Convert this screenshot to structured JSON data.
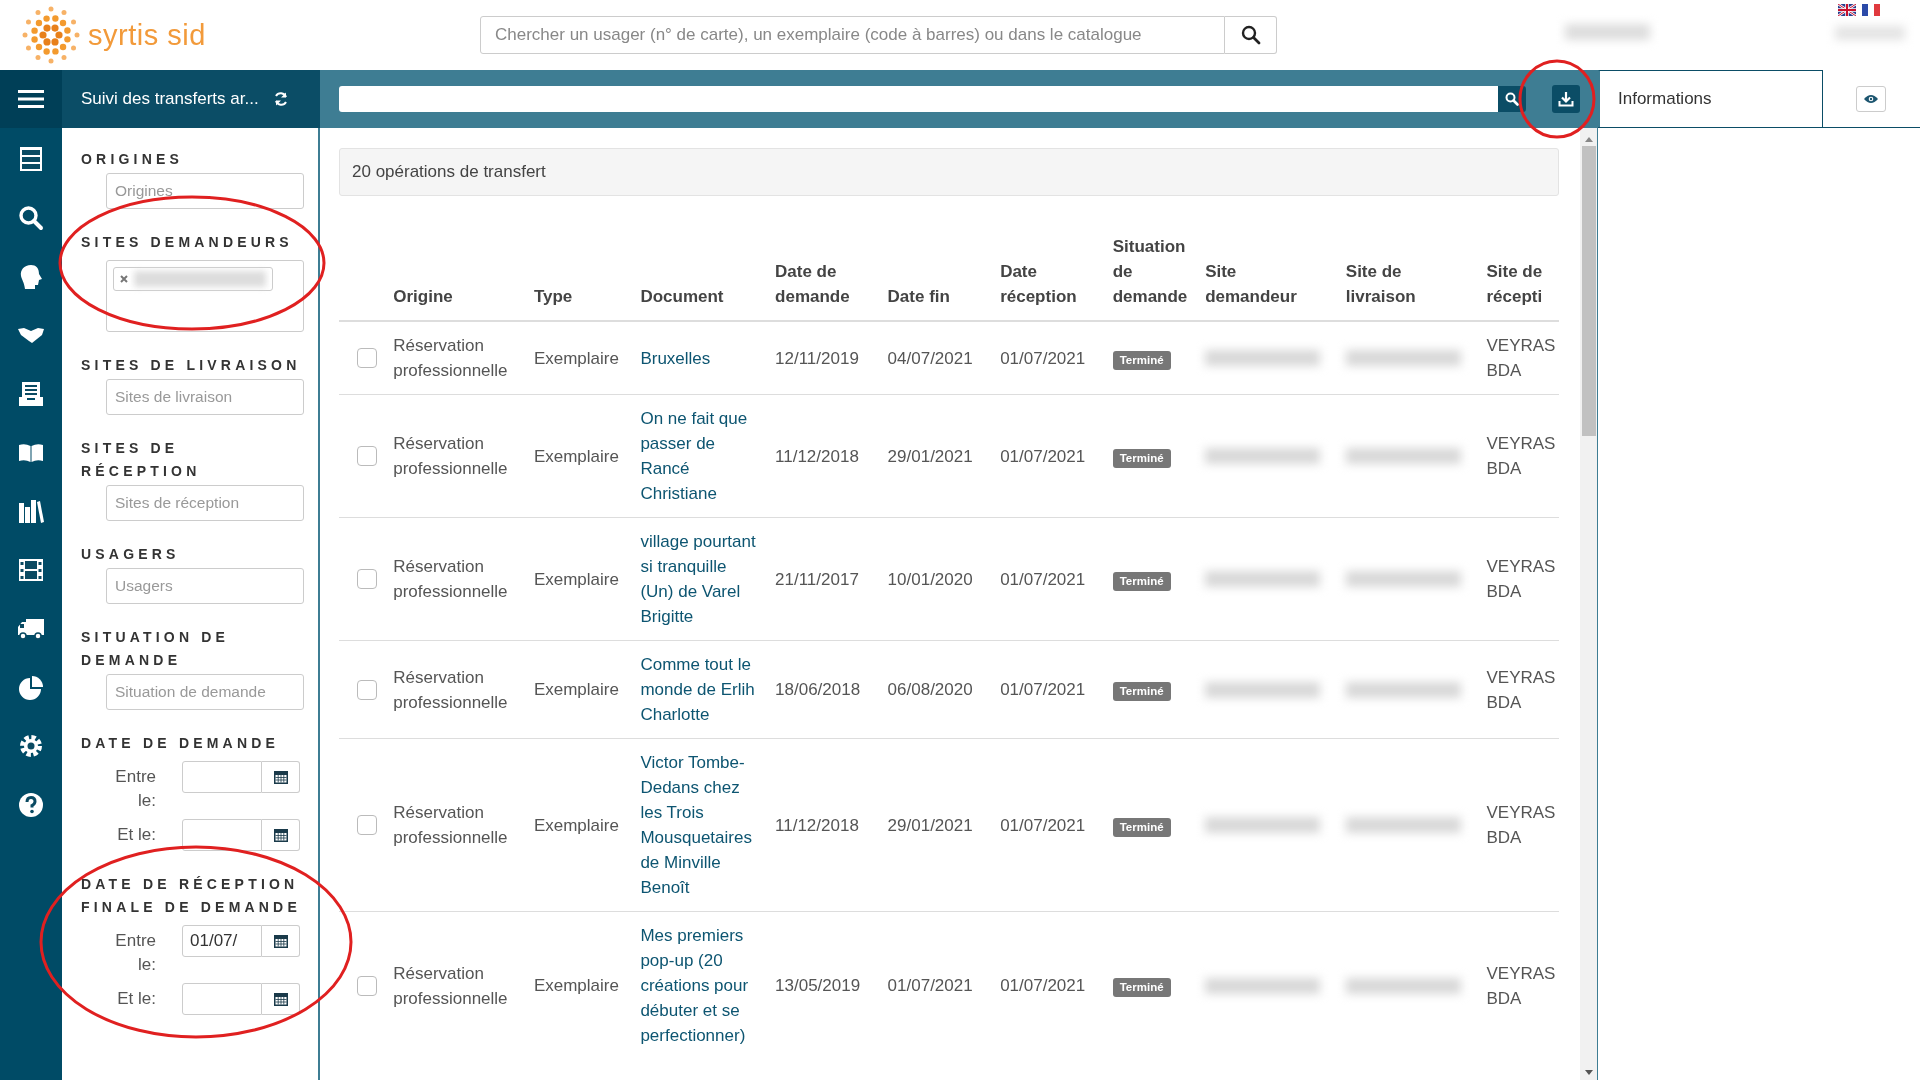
{
  "logo": {
    "text": "syrtis sid"
  },
  "global_search": {
    "placeholder": "Chercher un usager (n° de carte), un exemplaire (code à barres) ou dans le catalogue"
  },
  "page_title": "Suivi des transferts ar...",
  "info_tab": {
    "label": "Informations",
    "selected": true
  },
  "filters": [
    {
      "kind": "select",
      "label": "ORIGINES",
      "placeholder": "Origines"
    },
    {
      "kind": "tags",
      "label": "SITES DEMANDEURS"
    },
    {
      "kind": "select",
      "label": "SITES DE LIVRAISON",
      "placeholder": "Sites de livraison"
    },
    {
      "kind": "select",
      "label": "SITES DE RÉCEPTION",
      "placeholder": "Sites de réception"
    },
    {
      "kind": "select",
      "label": "USAGERS",
      "placeholder": "Usagers"
    },
    {
      "kind": "select",
      "label": "SITUATION DE DEMANDE",
      "placeholder": "Situation de demande"
    },
    {
      "kind": "daterange",
      "label": "DATE DE DEMANDE",
      "from_label": "Entre le:",
      "to_label": "Et le:"
    },
    {
      "kind": "daterange",
      "label": "DATE DE RÉCEPTION FINALE DE DEMANDE",
      "from_label": "Entre le:",
      "from_value": "01/07/",
      "to_label": "Et le:"
    }
  ],
  "summary": "20 opérations de transfert",
  "table": {
    "columns": [
      "Origine",
      "Type",
      "Document",
      "Date de demande",
      "Date fin",
      "Date réception",
      "Situation de demande",
      "Site demandeur",
      "Site de livraison",
      "Site de récepti"
    ],
    "rows": [
      {
        "selected": false,
        "origine": "Réservation professionnelle",
        "type": "Exemplaire",
        "document": "Bruxelles",
        "date_demande": "12/11/2019",
        "date_fin": "04/07/2021",
        "date_reception": "01/07/2021",
        "situation": "Terminé",
        "site_reception": "VEYRAS BDA"
      },
      {
        "selected": false,
        "origine": "Réservation professionnelle",
        "type": "Exemplaire",
        "document": "On ne fait que passer de Rancé Christiane",
        "date_demande": "11/12/2018",
        "date_fin": "29/01/2021",
        "date_reception": "01/07/2021",
        "situation": "Terminé",
        "site_reception": "VEYRAS BDA"
      },
      {
        "selected": false,
        "origine": "Réservation professionnelle",
        "type": "Exemplaire",
        "document": "village pourtant si tranquille (Un) de Varel Brigitte",
        "date_demande": "21/11/2017",
        "date_fin": "10/01/2020",
        "date_reception": "01/07/2021",
        "situation": "Terminé",
        "site_reception": "VEYRAS BDA"
      },
      {
        "selected": false,
        "origine": "Réservation professionnelle",
        "type": "Exemplaire",
        "document": "Comme tout le monde de Erlih Charlotte",
        "date_demande": "18/06/2018",
        "date_fin": "06/08/2020",
        "date_reception": "01/07/2021",
        "situation": "Terminé",
        "site_reception": "VEYRAS BDA"
      },
      {
        "selected": false,
        "origine": "Réservation professionnelle",
        "type": "Exemplaire",
        "document": "Victor Tombe-Dedans chez les Trois Mousquetaires de Minville Benoît",
        "date_demande": "11/12/2018",
        "date_fin": "29/01/2021",
        "date_reception": "01/07/2021",
        "situation": "Terminé",
        "site_reception": "VEYRAS BDA"
      },
      {
        "selected": false,
        "origine": "Réservation professionnelle",
        "type": "Exemplaire",
        "document": "Mes premiers pop-up (20 créations pour débuter et se perfectionner)",
        "date_demande": "13/05/2019",
        "date_fin": "01/07/2021",
        "date_reception": "01/07/2021",
        "situation": "Terminé",
        "site_reception": "VEYRAS BDA"
      }
    ]
  }
}
